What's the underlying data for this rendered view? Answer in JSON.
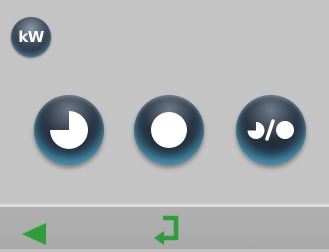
{
  "header": {
    "unit_badge_label": "kW",
    "unit_badge_icon": "power-unit-icon"
  },
  "mode_buttons": [
    {
      "icon": "three-quarter-pie-icon"
    },
    {
      "icon": "full-circle-icon"
    },
    {
      "icon": "half-or-full-circle-icon"
    }
  ],
  "footer": {
    "back_icon": "left-arrow-icon",
    "enter_icon": "enter-return-icon",
    "accent_color": "#2e9e3a"
  },
  "colors": {
    "background": "#c4c4c4",
    "footer_background": "#aeaeae",
    "button_glow": "#5ab9e1",
    "button_dark": "#141b25"
  }
}
